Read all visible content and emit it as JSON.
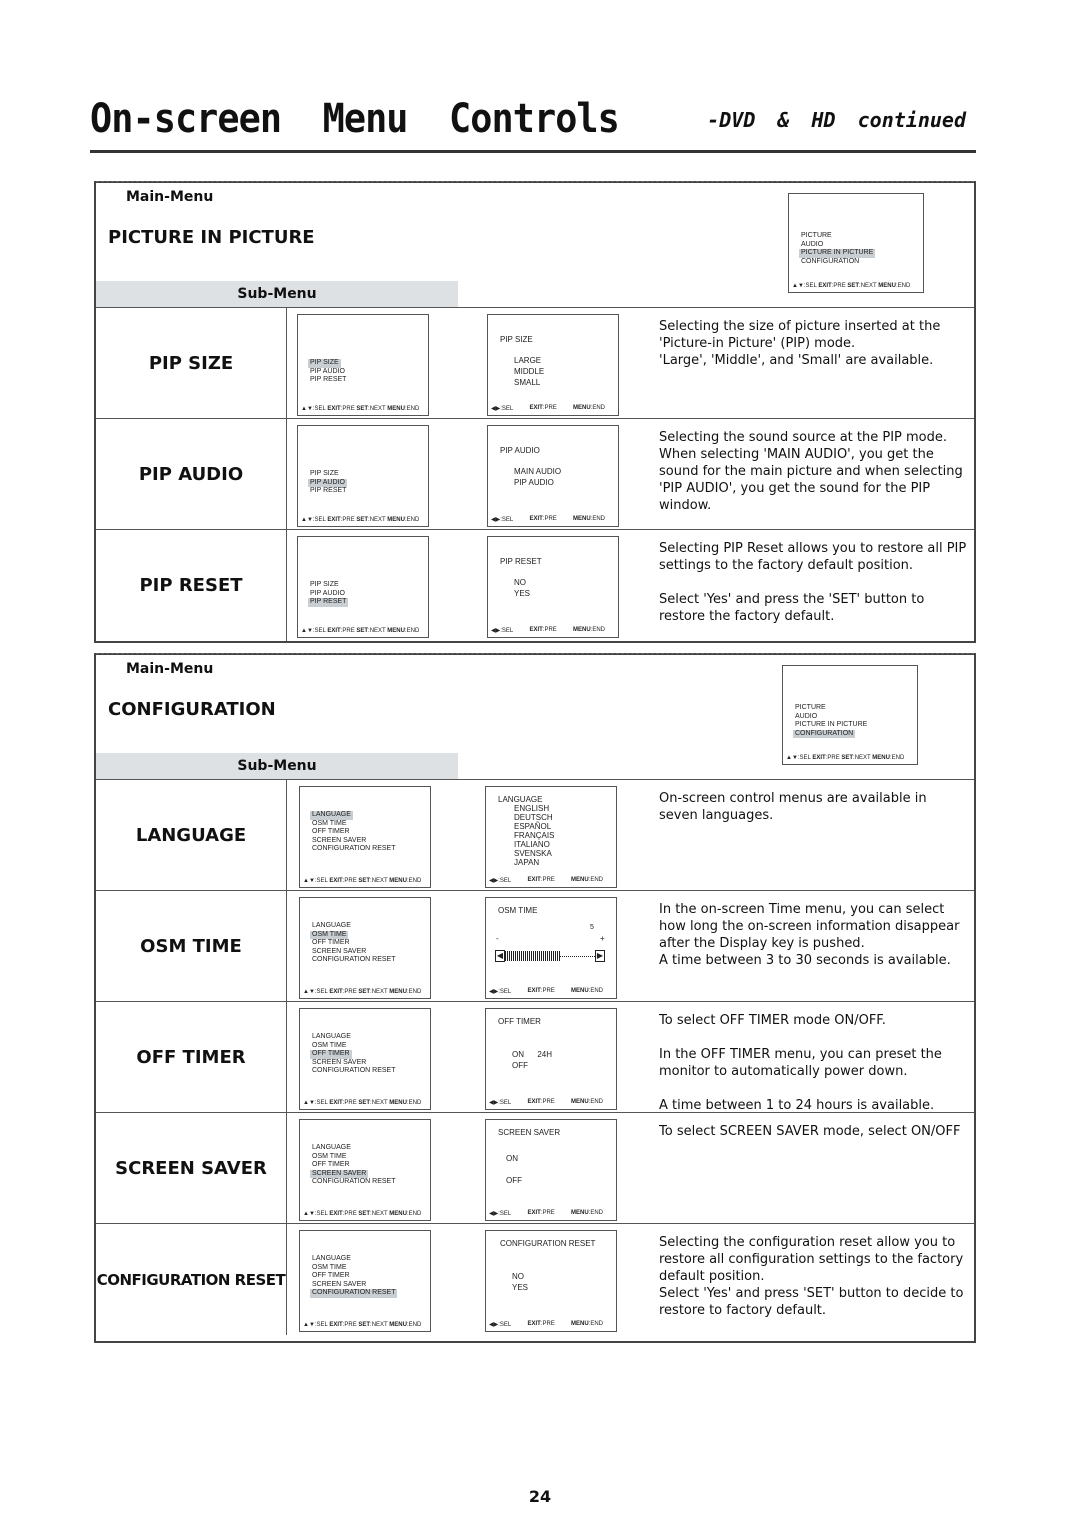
{
  "page": {
    "title": "On-screen Menu Controls",
    "subtitle": "-DVD & HD continued",
    "page_number": "24"
  },
  "common": {
    "main_menu_label": "Main-Menu",
    "sub_menu_label": "Sub-Menu",
    "footer_main": {
      "arrows": "▲▼",
      "sel": ":SEL ",
      "exit": "EXIT",
      "pre": ":PRE ",
      "set": "SET",
      "next": ":NEXT ",
      "menu": "MENU",
      "end": ":END"
    },
    "footer_sub": {
      "arrows": "◀▶",
      "sel": ":SEL",
      "exit": "EXIT",
      "pre": ":PRE",
      "menu": "MENU",
      "end": ":END"
    }
  },
  "main_menu_items": [
    "PICTURE",
    "AUDIO",
    "PICTURE IN PICTURE",
    "CONFIGURATION"
  ],
  "pip_items": [
    "PIP SIZE",
    "PIP AUDIO",
    "PIP RESET"
  ],
  "config_items": [
    "LANGUAGE",
    "OSM TIME",
    "OFF TIMER",
    "SCREEN SAVER",
    "CONFIGURATION RESET"
  ],
  "sections": [
    {
      "title": "PICTURE IN PICTURE",
      "main_selected": 2,
      "rows": [
        {
          "label": "PIP SIZE",
          "selected": 0,
          "osd_title": "PIP SIZE",
          "options": [
            "LARGE",
            "MIDDLE",
            "SMALL"
          ],
          "desc": [
            "Selecting the size of picture inserted at the 'Picture-in Picture' (PIP) mode.",
            "'Large', 'Middle', and 'Small' are available."
          ]
        },
        {
          "label": "PIP AUDIO",
          "selected": 1,
          "osd_title": "PIP AUDIO",
          "options": [
            "MAIN AUDIO",
            "PIP AUDIO"
          ],
          "desc": [
            "Selecting the sound source at the PIP mode. When selecting 'MAIN AUDIO', you get the sound for the main picture and when selecting 'PIP AUDIO', you get the sound for the PIP window."
          ]
        },
        {
          "label": "PIP RESET",
          "selected": 2,
          "osd_title": "PIP RESET",
          "options": [
            "NO",
            "YES"
          ],
          "desc": [
            "Selecting PIP Reset allows you to restore all PIP settings to the factory default position.",
            "Select 'Yes' and press the 'SET' button to restore the factory default."
          ]
        }
      ]
    },
    {
      "title": "CONFIGURATION",
      "main_selected": 3,
      "rows": [
        {
          "label": "LANGUAGE",
          "selected": 0,
          "osd_title": "LANGUAGE",
          "options": [
            "ENGLISH",
            "DEUTSCH",
            "ESPAÑOL",
            "FRANÇAIS",
            "ITALIANO",
            "SVENSKA",
            "JAPAN"
          ],
          "desc": [
            "On-screen control menus are available in seven languages."
          ]
        },
        {
          "label": "OSM TIME",
          "selected": 1,
          "osd_title": "OSM TIME",
          "slider": {
            "value": "5",
            "minus": "-",
            "plus": "+",
            "fill_fraction": 0.5
          },
          "desc": [
            "In the on-screen Time menu, you can select how long the on-screen information disappear after the Display key is pushed.",
            "A time between 3 to 30 seconds is available."
          ]
        },
        {
          "label": "OFF TIMER",
          "selected": 2,
          "osd_title": "OFF TIMER",
          "options": [
            "ON      24H",
            "OFF"
          ],
          "desc": [
            "To select OFF TIMER mode ON/OFF.",
            "In the OFF TIMER menu, you can preset the monitor to automatically power down.",
            "A time between 1 to 24 hours is available."
          ]
        },
        {
          "label": "SCREEN SAVER",
          "selected": 3,
          "osd_title": "SCREEN SAVER",
          "options": [
            "ON",
            "OFF"
          ],
          "desc": [
            "To select SCREEN SAVER mode, select ON/OFF"
          ]
        },
        {
          "label": "CONFIGURATION RESET",
          "selected": 4,
          "osd_title": "CONFIGURATION RESET",
          "options": [
            "NO",
            "YES"
          ],
          "desc": [
            "Selecting the configuration reset allow you to restore all configuration settings to the factory default position.",
            "Select 'Yes' and press 'SET' button to decide to restore to factory default."
          ]
        }
      ]
    }
  ]
}
